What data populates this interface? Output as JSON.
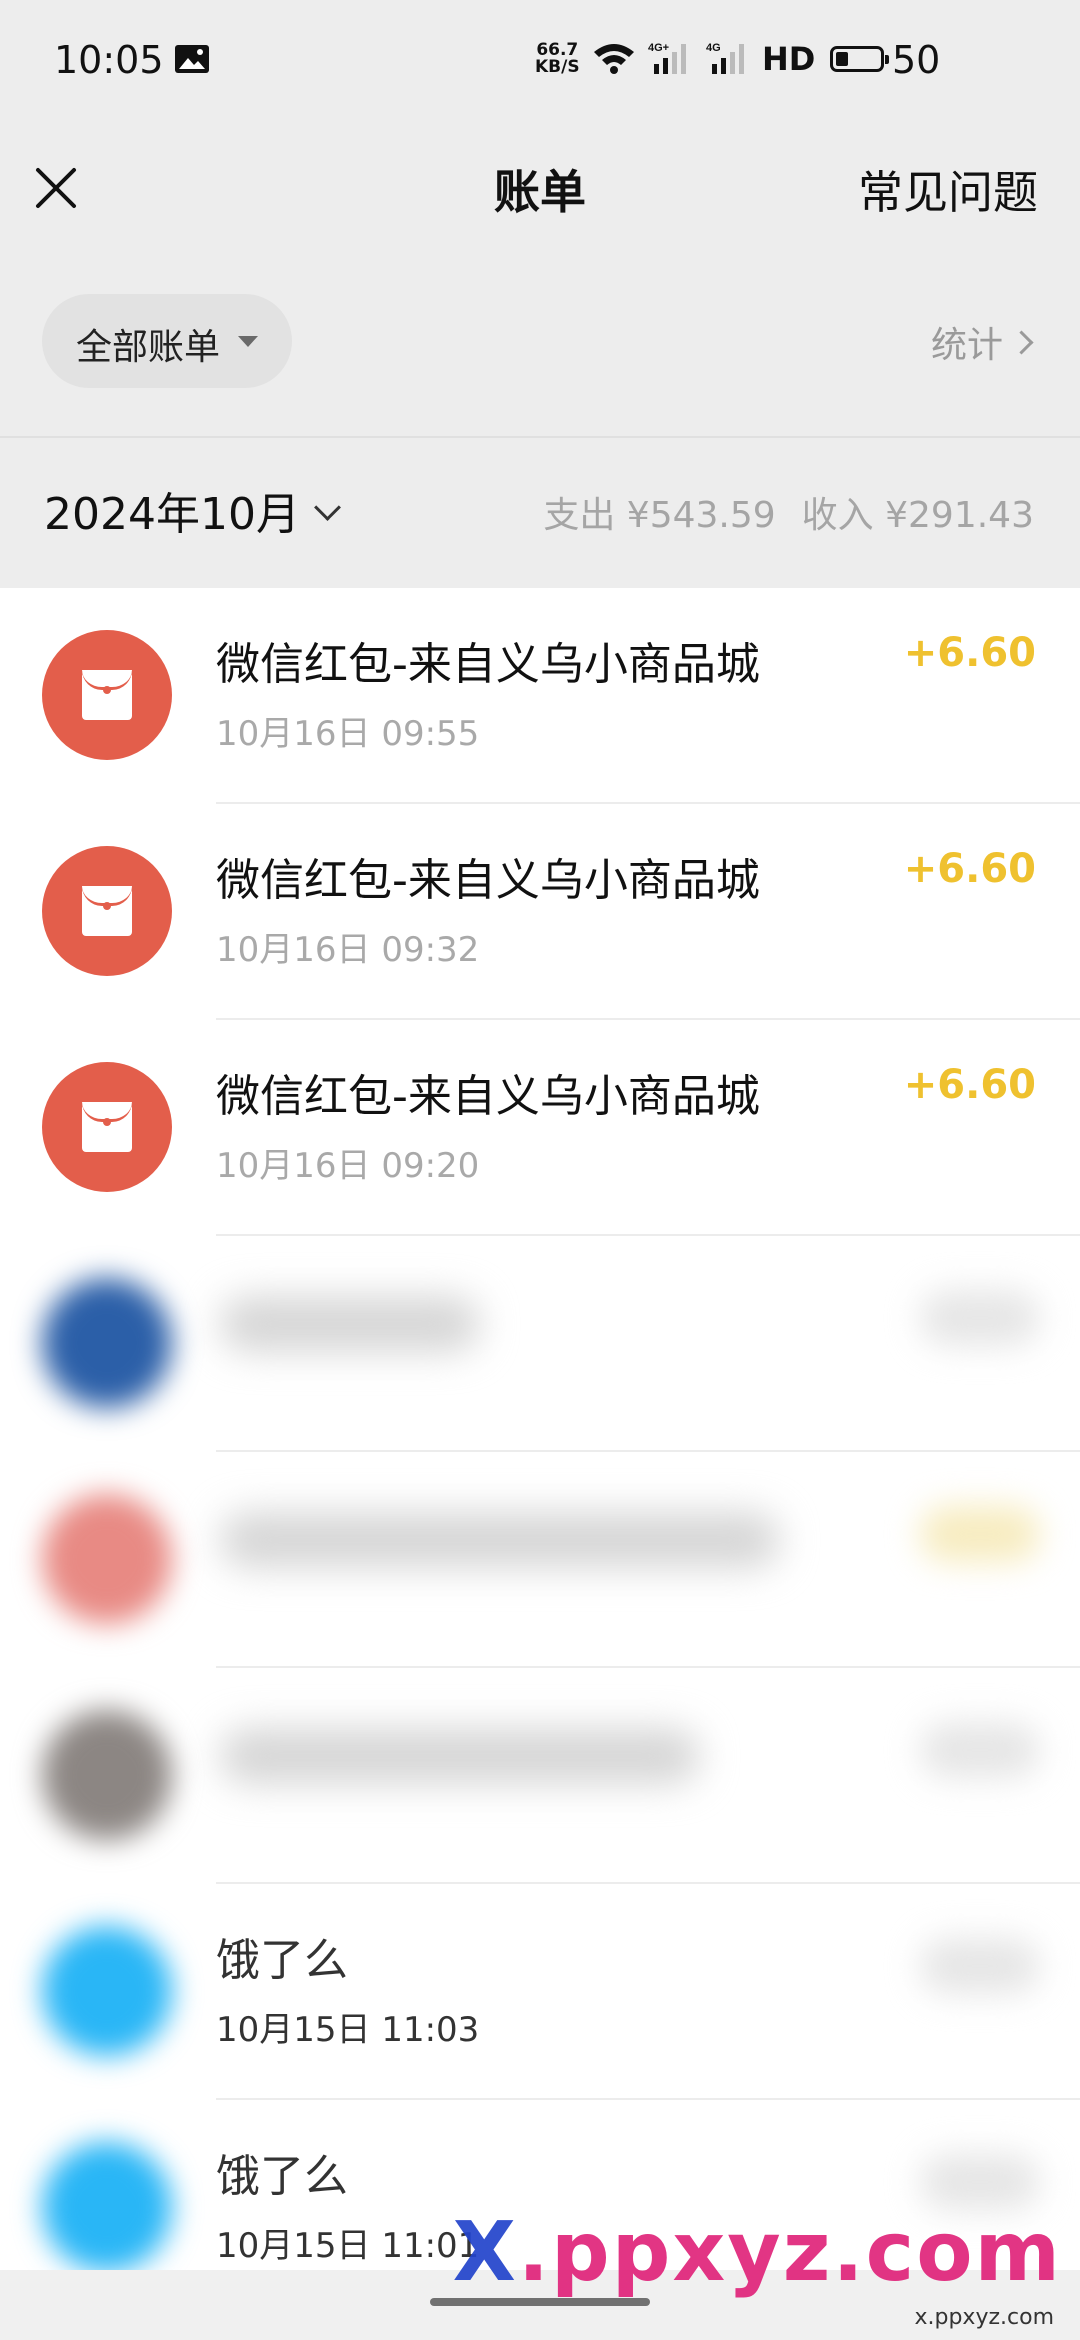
{
  "status_bar": {
    "time": "10:05",
    "network_speed_value": "66.7",
    "network_speed_unit": "KB/S",
    "hd_label": "HD",
    "battery": "50",
    "icons": [
      "photo-icon",
      "wifi-icon",
      "signal-icon",
      "signal-icon",
      "battery-icon"
    ]
  },
  "nav": {
    "title": "账单",
    "faq": "常见问题"
  },
  "filter": {
    "label": "全部账单",
    "stats": "统计"
  },
  "month": {
    "label": "2024年10月",
    "expense": "支出 ¥543.59",
    "income": "收入 ¥291.43"
  },
  "transactions": [
    {
      "title": "微信红包-来自义乌小商品城",
      "time": "10月16日 09:55",
      "amount": "+6.60",
      "icon": "red-envelope-icon"
    },
    {
      "title": "微信红包-来自义乌小商品城",
      "time": "10月16日 09:32",
      "amount": "+6.60",
      "icon": "red-envelope-icon"
    },
    {
      "title": "微信红包-来自义乌小商品城",
      "time": "10月16日 09:20",
      "amount": "+6.60",
      "icon": "red-envelope-icon"
    },
    {
      "title": "",
      "time": "",
      "amount": ""
    },
    {
      "title": "",
      "time": "",
      "amount": ""
    },
    {
      "title": "",
      "time": "",
      "amount": ""
    },
    {
      "title": "饿了么",
      "time": "10月15日 11:03",
      "amount": ""
    },
    {
      "title": "饿了么",
      "time": "10月15日 11:01",
      "amount": ""
    }
  ],
  "colors": {
    "header_bg": "#ededed",
    "red_envelope": "#e35e4b",
    "income_amount": "#efc12f",
    "secondary_text": "#a9a9a9"
  },
  "watermark": {
    "text_x": "X",
    "text_main": ".ppxyz.com",
    "sub": "x.ppxyz.com"
  }
}
